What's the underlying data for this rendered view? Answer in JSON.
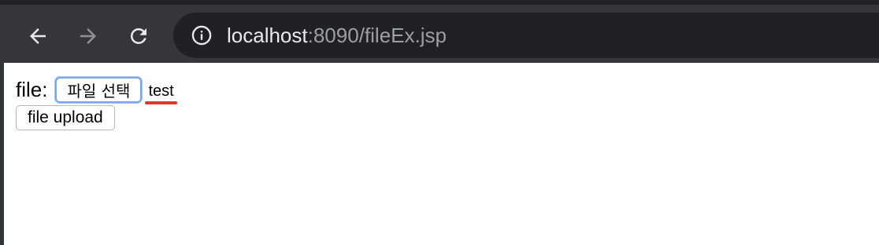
{
  "browser": {
    "url_host": "localhost",
    "url_path": ":8090/fileEx.jsp",
    "icons": {
      "back": "back-arrow-icon",
      "forward": "forward-arrow-icon",
      "reload": "reload-icon",
      "info": "info-icon"
    },
    "colors": {
      "toolbar": "#35363a",
      "omnibox": "#202124",
      "host_text": "#e8eaed",
      "path_text": "#9aa0a6"
    }
  },
  "form": {
    "file_label": "file:",
    "choose_file_button": "파일 선택",
    "selected_file_name": "test",
    "upload_button": "file upload"
  }
}
